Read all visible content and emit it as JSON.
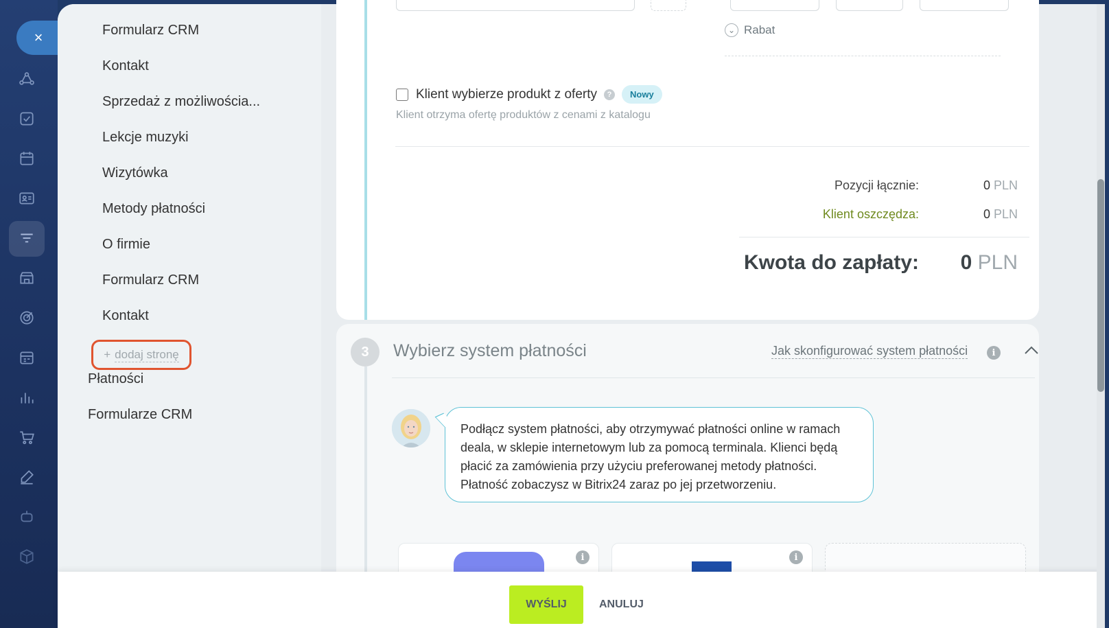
{
  "close_label": "×",
  "menu": {
    "items": [
      "Formularz CRM",
      "Kontakt",
      "Sprzedaż z możliwościa...",
      "Lekcje muzyki",
      "Wizytówka",
      "Metody płatności",
      "O firmie",
      "Formularz CRM",
      "Kontakt"
    ],
    "add_page_plus": "+",
    "add_page_label": "dodaj stronę",
    "top_items": [
      "Płatności",
      "Formularze CRM"
    ]
  },
  "products": {
    "rabat_label": "Rabat",
    "client_choose_label": "Klient wybierze produkt z oferty",
    "help_mark": "?",
    "new_badge": "Nowy",
    "client_choose_hint": "Klient otrzyma ofertę produktów z cenami z katalogu"
  },
  "summary": {
    "total_items_label": "Pozycji łącznie:",
    "total_items_value": "0",
    "savings_label": "Klient oszczędza:",
    "savings_value": "0",
    "amount_label": "Kwota do zapłaty:",
    "amount_value": "0",
    "currency": "PLN"
  },
  "step3": {
    "number": "3",
    "title": "Wybierz system płatności",
    "help_link": "Jak skonfigurować system płatności",
    "info_mark": "i",
    "collapse_icon": "^",
    "assistant_message": "Podłącz system płatności, aby otrzymywać płatności online w ramach deala, w sklepie internetowym lub za pomocą terminala. Klienci będą płacić za zamówienia przy użyciu preferowanej metody płatności. Płatność zobaczysz w Bitrix24 zaraz po jej przetworzeniu."
  },
  "actions": {
    "send_label": "WYŚLIJ",
    "cancel_label": "ANULUJ"
  },
  "colors": {
    "accent": "#5ec2d6",
    "send_button": "#bbed21",
    "highlight": "#e0542f"
  }
}
